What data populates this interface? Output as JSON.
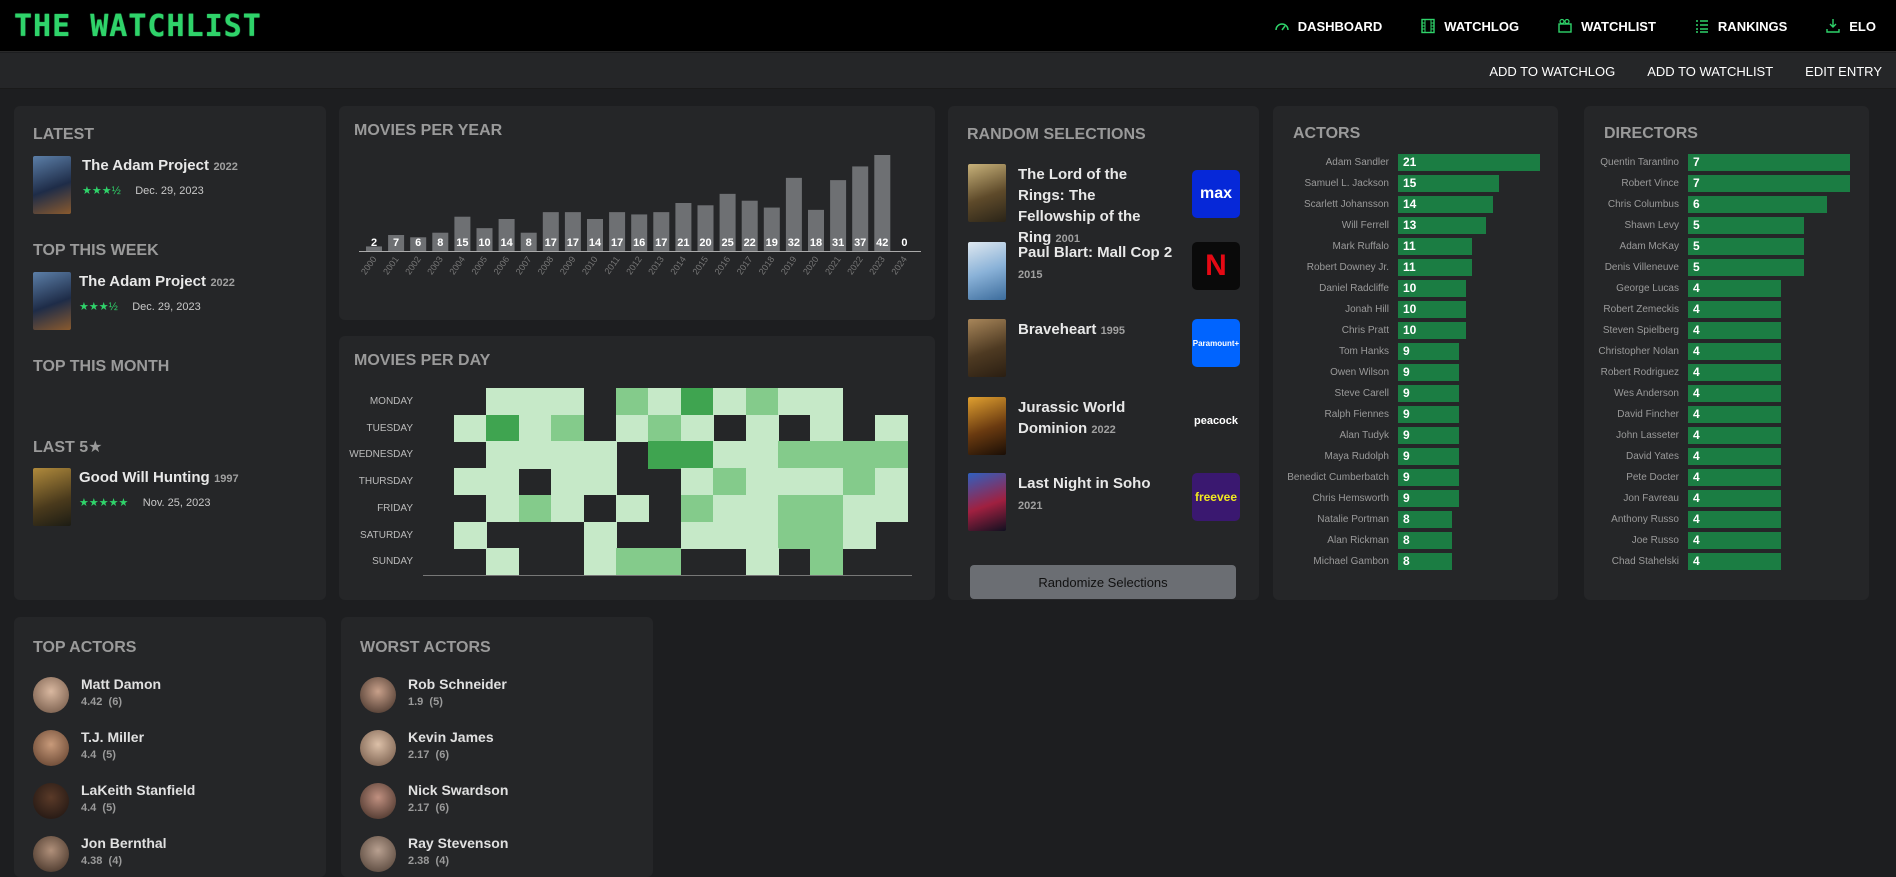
{
  "app": {
    "title": "THE WATCHLIST"
  },
  "nav": [
    {
      "label": "DASHBOARD",
      "icon": "gauge-icon"
    },
    {
      "label": "WATCHLOG",
      "icon": "film-icon"
    },
    {
      "label": "WATCHLIST",
      "icon": "clapperboard-icon"
    },
    {
      "label": "RANKINGS",
      "icon": "list-icon"
    },
    {
      "label": "ELO",
      "icon": "download-icon"
    }
  ],
  "sub_actions": [
    "ADD TO WATCHLOG",
    "ADD TO WATCHLIST",
    "EDIT ENTRY"
  ],
  "latest": {
    "heading": "LATEST",
    "title": "The Adam Project",
    "year": "2022",
    "stars": "★★★½",
    "date": "Dec. 29, 2023"
  },
  "top_week": {
    "heading": "TOP THIS WEEK",
    "title": "The Adam Project",
    "year": "2022",
    "stars": "★★★½",
    "date": "Dec. 29, 2023"
  },
  "top_month": {
    "heading": "TOP THIS MONTH"
  },
  "last5": {
    "heading": "LAST 5★",
    "title": "Good Will Hunting",
    "year": "1997",
    "stars": "★★★★★",
    "date": "Nov. 25, 2023"
  },
  "movies_per_year": {
    "heading": "MOVIES PER YEAR",
    "chart_data": {
      "type": "bar",
      "categories": [
        "2000",
        "2001",
        "2002",
        "2003",
        "2004",
        "2005",
        "2006",
        "2007",
        "2008",
        "2009",
        "2010",
        "2011",
        "2012",
        "2013",
        "2014",
        "2015",
        "2016",
        "2017",
        "2018",
        "2019",
        "2020",
        "2021",
        "2022",
        "2023",
        "2024"
      ],
      "values": [
        2,
        7,
        6,
        8,
        15,
        10,
        14,
        8,
        17,
        17,
        14,
        17,
        16,
        17,
        21,
        20,
        25,
        22,
        19,
        32,
        18,
        31,
        37,
        42,
        0
      ]
    }
  },
  "movies_per_day": {
    "heading": "MOVIES PER DAY",
    "days": [
      "MONDAY",
      "TUESDAY",
      "WEDNESDAY",
      "THURSDAY",
      "FRIDAY",
      "SATURDAY",
      "SUNDAY"
    ],
    "chart_data": {
      "type": "heatmap",
      "rows": [
        "MONDAY",
        "TUESDAY",
        "WEDNESDAY",
        "THURSDAY",
        "FRIDAY",
        "SATURDAY",
        "SUNDAY"
      ],
      "values": [
        [
          0,
          1,
          1,
          1,
          0,
          2,
          1,
          3,
          1,
          2,
          1,
          1,
          0,
          0
        ],
        [
          1,
          3,
          1,
          2,
          0,
          1,
          2,
          1,
          0,
          1,
          0,
          1,
          0,
          1
        ],
        [
          0,
          1,
          1,
          1,
          1,
          0,
          3,
          3,
          1,
          1,
          2,
          2,
          2,
          2
        ],
        [
          1,
          1,
          0,
          1,
          1,
          0,
          0,
          1,
          2,
          1,
          1,
          1,
          2,
          1
        ],
        [
          0,
          1,
          2,
          1,
          0,
          1,
          0,
          2,
          1,
          1,
          2,
          2,
          1,
          1
        ],
        [
          1,
          0,
          0,
          0,
          1,
          0,
          0,
          1,
          1,
          1,
          2,
          2,
          1,
          0
        ],
        [
          0,
          1,
          0,
          0,
          1,
          2,
          2,
          0,
          0,
          1,
          0,
          2,
          0,
          0
        ]
      ]
    }
  },
  "random": {
    "heading": "RANDOM SELECTIONS",
    "button": "Randomize Selections",
    "items": [
      {
        "title": "The Lord of the Rings: The Fellowship of the Ring",
        "year": "2001",
        "service": "max"
      },
      {
        "title": "Paul Blart: Mall Cop 2",
        "year": "2015",
        "service": "N"
      },
      {
        "title": "Braveheart",
        "year": "1995",
        "service": "Paramount+"
      },
      {
        "title": "Jurassic World Dominion",
        "year": "2022",
        "service": "peacock"
      },
      {
        "title": "Last Night in Soho",
        "year": "2021",
        "service": "freevee"
      }
    ]
  },
  "actors": {
    "heading": "ACTORS",
    "chart_data": {
      "type": "bar",
      "categories": [
        "Adam Sandler",
        "Samuel L. Jackson",
        "Scarlett Johansson",
        "Will Ferrell",
        "Mark Ruffalo",
        "Robert Downey Jr.",
        "Daniel Radcliffe",
        "Jonah Hill",
        "Chris Pratt",
        "Tom Hanks",
        "Owen Wilson",
        "Steve Carell",
        "Ralph Fiennes",
        "Alan Tudyk",
        "Maya Rudolph",
        "Benedict Cumberbatch",
        "Chris Hemsworth",
        "Natalie Portman",
        "Alan Rickman",
        "Michael Gambon"
      ],
      "values": [
        21,
        15,
        14,
        13,
        11,
        11,
        10,
        10,
        10,
        9,
        9,
        9,
        9,
        9,
        9,
        9,
        9,
        8,
        8,
        8
      ]
    }
  },
  "directors": {
    "heading": "DIRECTORS",
    "chart_data": {
      "type": "bar",
      "categories": [
        "Quentin Tarantino",
        "Robert Vince",
        "Chris Columbus",
        "Shawn Levy",
        "Adam McKay",
        "Denis Villeneuve",
        "George Lucas",
        "Robert Zemeckis",
        "Steven Spielberg",
        "Christopher Nolan",
        "Robert Rodriguez",
        "Wes Anderson",
        "David Fincher",
        "John Lasseter",
        "David Yates",
        "Pete Docter",
        "Jon Favreau",
        "Anthony Russo",
        "Joe Russo",
        "Chad Stahelski"
      ],
      "values": [
        7,
        7,
        6,
        5,
        5,
        5,
        4,
        4,
        4,
        4,
        4,
        4,
        4,
        4,
        4,
        4,
        4,
        4,
        4,
        4
      ]
    }
  },
  "top_actors": {
    "heading": "TOP ACTORS",
    "items": [
      {
        "name": "Matt Damon",
        "score": "4.42",
        "count": "(6)"
      },
      {
        "name": "T.J. Miller",
        "score": "4.4",
        "count": "(5)"
      },
      {
        "name": "LaKeith Stanfield",
        "score": "4.4",
        "count": "(5)"
      },
      {
        "name": "Jon Bernthal",
        "score": "4.38",
        "count": "(4)"
      }
    ]
  },
  "worst_actors": {
    "heading": "WORST ACTORS",
    "items": [
      {
        "name": "Rob Schneider",
        "score": "1.9",
        "count": "(5)"
      },
      {
        "name": "Kevin James",
        "score": "2.17",
        "count": "(6)"
      },
      {
        "name": "Nick Swardson",
        "score": "2.17",
        "count": "(6)"
      },
      {
        "name": "Ray Stevenson",
        "score": "2.38",
        "count": "(4)"
      }
    ]
  },
  "colors": {
    "accent": "#2fd36a",
    "bar": "#1b7d43",
    "bg": "#1d1e20",
    "card": "#252628"
  }
}
